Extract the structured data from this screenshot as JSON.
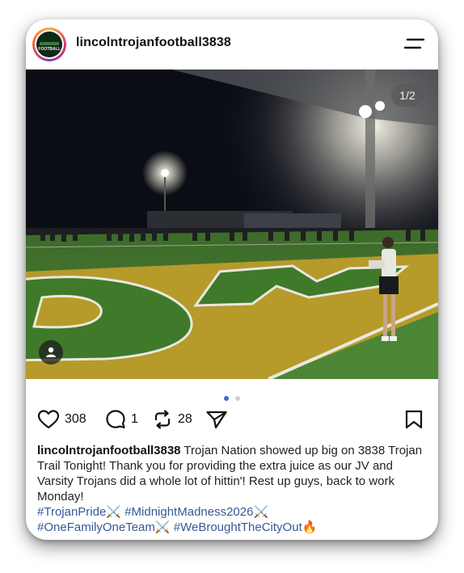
{
  "post": {
    "username": "lincolntrojanfootball3838",
    "avatar_text": "FOOTBALL",
    "image_counter": "1/2",
    "carousel_index": 1,
    "carousel_total": 2,
    "likes": "308",
    "comments": "1",
    "reposts": "28",
    "caption_user": "lincolntrojanfootball3838",
    "caption_text": " Trojan Nation showed up big on 3838 Trojan Trail Tonight! Thank you for providing the extra juice as our JV and Varsity Trojans did a whole lot of hittin'! Rest up guys, back to work Monday!",
    "hashtags": [
      {
        "tag": "#TrojanPride",
        "emoji": "⚔️"
      },
      {
        "tag": "#MidnightMadness2026",
        "emoji": "⚔️"
      },
      {
        "tag": "#OneFamilyOneTeam",
        "emoji": "⚔️"
      },
      {
        "tag": "#WeBroughtTheCityOut",
        "emoji": "🔥"
      }
    ]
  },
  "icons": {
    "menu": "menu-icon",
    "like": "heart-icon",
    "comment": "comment-icon",
    "repost": "repost-icon",
    "share": "send-icon",
    "save": "bookmark-icon",
    "tagged": "person-icon"
  },
  "colors": {
    "hashtag": "#385898",
    "dot_active": "#3a6bc9",
    "turf_green": "#3f7a2a",
    "endzone_gold": "#b69a2a"
  }
}
